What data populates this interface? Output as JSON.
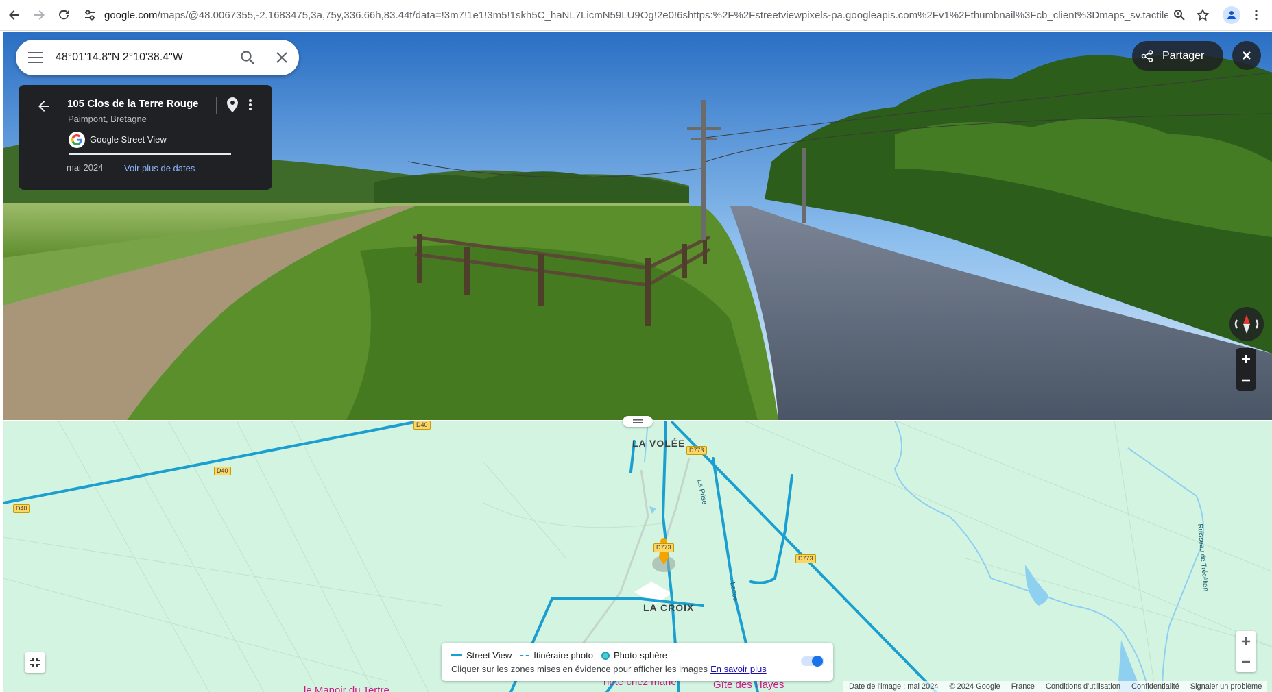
{
  "browser": {
    "url_host": "google.com",
    "url_rest": "/maps/@48.0067355,-2.1683475,3a,75y,336.66h,83.44t/data=!3m7!1e1!3m5!1skh5C_haNL7LicmN59LU9Og!2e0!6shttps:%2F%2Fstreetviewpixels-pa.googleapis.com%2Fv1%2Fthumbnail%3Fcb_client%3Dmaps_sv.tactile%26w%..."
  },
  "search": {
    "query": "48°01'14.8\"N 2°10'38.4\"W"
  },
  "info_card": {
    "title": "105 Clos de la Terre Rouge",
    "subtitle": "Paimpont, Bretagne",
    "source": "Google Street View",
    "date": "mai 2024",
    "more_dates": "Voir plus de dates"
  },
  "pano": {
    "share_label": "Partager"
  },
  "map": {
    "places": [
      "LA VOLÉE",
      "LA CROIX"
    ],
    "pois": [
      "le Manoir du Tertre",
      "hote chez marie",
      "Gîte des Hayes"
    ],
    "streets": [
      "La Prise",
      "Lanoe",
      "Ruisseau de Trécélien"
    ],
    "road_badges": [
      "D40",
      "D40",
      "D40",
      "D773",
      "D773",
      "D773"
    ]
  },
  "legend": {
    "street_view": "Street View",
    "photo_route": "Itinéraire photo",
    "photo_sphere": "Photo-sphère",
    "hint": "Cliquer sur les zones mises en évidence pour afficher les images",
    "learn_more": "En savoir plus"
  },
  "footer": {
    "image_date": "Date de l'image : mai 2024",
    "copyright": "© 2024 Google",
    "country": "France",
    "terms": "Conditions d'utilisation",
    "privacy": "Confidentialité",
    "report": "Signaler un problème"
  },
  "colors": {
    "map_bg": "#d4f4e2",
    "coverage_line": "#1a9fd0",
    "card_bg": "#202124",
    "link": "#8ab4f8"
  }
}
